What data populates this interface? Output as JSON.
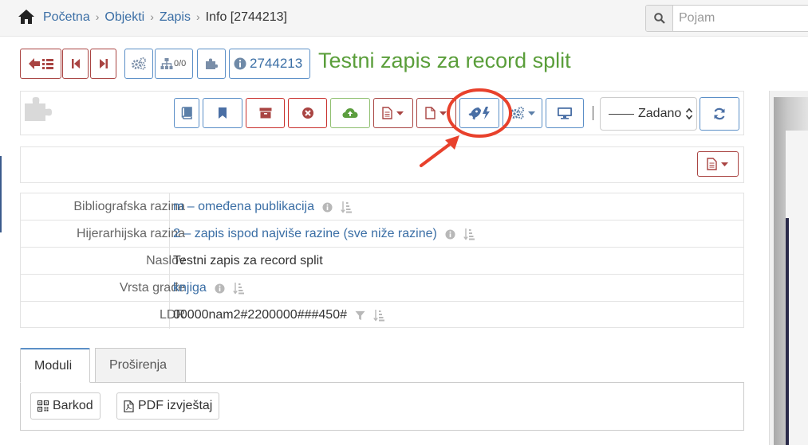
{
  "breadcrumb": {
    "home": "Početna",
    "objects": "Objekti",
    "record": "Zapis",
    "current": "Info [2744213]"
  },
  "search": {
    "placeholder": "Pojam"
  },
  "toolbar": {
    "hierarchy_count": "0/0",
    "record_id": "2744213"
  },
  "page_title": "Testni zapis za record split",
  "display_select": {
    "value": "Zadano"
  },
  "info": {
    "rows": [
      {
        "label": "Bibliografska razina",
        "value": "m – omeđena publikacija"
      },
      {
        "label": "Hijerarhijska razina",
        "value": "2 – zapis ispod najviše razine (sve niže razine)"
      },
      {
        "label": "Naslov",
        "value": "Testni zapis za record split"
      },
      {
        "label": "Vrsta građe",
        "value": "knjiga"
      },
      {
        "label": "LDR",
        "value": "00000nam2#2200000###450#"
      }
    ]
  },
  "tabs": [
    {
      "label": "Moduli"
    },
    {
      "label": "Proširenja"
    }
  ],
  "modules": {
    "barcode": "Barkod",
    "pdf_report": "PDF izvještaj"
  },
  "colors": {
    "title_green": "#5a9e3a",
    "link_blue": "#3a6ea5",
    "annotation_red": "#e8412c"
  }
}
